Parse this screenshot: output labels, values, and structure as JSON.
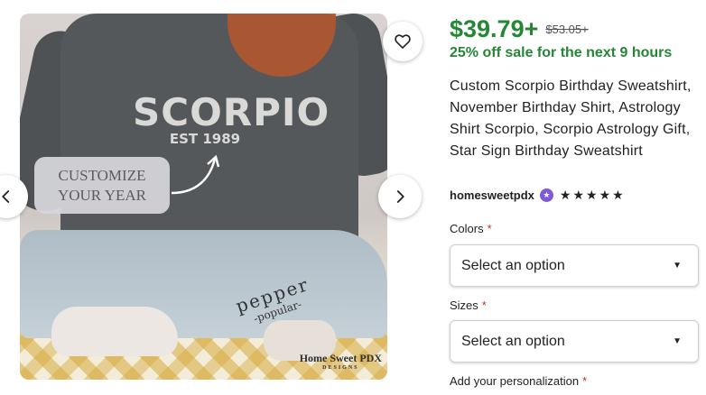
{
  "colors": {
    "price_green": "#258635",
    "required_red": "#c4312b",
    "star_seller_purple": "#7f5ad8"
  },
  "product_image": {
    "shirt_text": "SCORPIO",
    "shirt_subtext": "EST 1989",
    "overlay_line1": "CUSTOMIZE",
    "overlay_line2": "YOUR YEAR",
    "leg_text_line1": "pepper",
    "leg_text_line2": "-popular-",
    "watermark_main": "Home Sweet PDX",
    "watermark_sub": "DESIGNS"
  },
  "controls": {
    "favorite_icon": "heart-icon",
    "prev_icon": "chevron-left-icon",
    "next_icon": "chevron-right-icon"
  },
  "pricing": {
    "price": "$39.79+",
    "original_price": "$53.05+",
    "sale_text": "25% off sale for the next 9 hours"
  },
  "listing": {
    "title": "Custom Scorpio Birthday Sweatshirt, November Birthday Shirt, Astrology Shirt Scorpio, Scorpio Astrology Gift, Star Sign Birthday Sweatshirt"
  },
  "shop": {
    "name": "homesweetpdx",
    "badge_icon": "star-seller-badge-icon",
    "rating": 5,
    "stars": [
      "★",
      "★",
      "★",
      "★",
      "★"
    ]
  },
  "options": {
    "colors_label": "Colors",
    "colors_value": "Select an option",
    "sizes_label": "Sizes",
    "sizes_value": "Select an option",
    "personalization_label": "Add your personalization",
    "required_mark": "*"
  }
}
